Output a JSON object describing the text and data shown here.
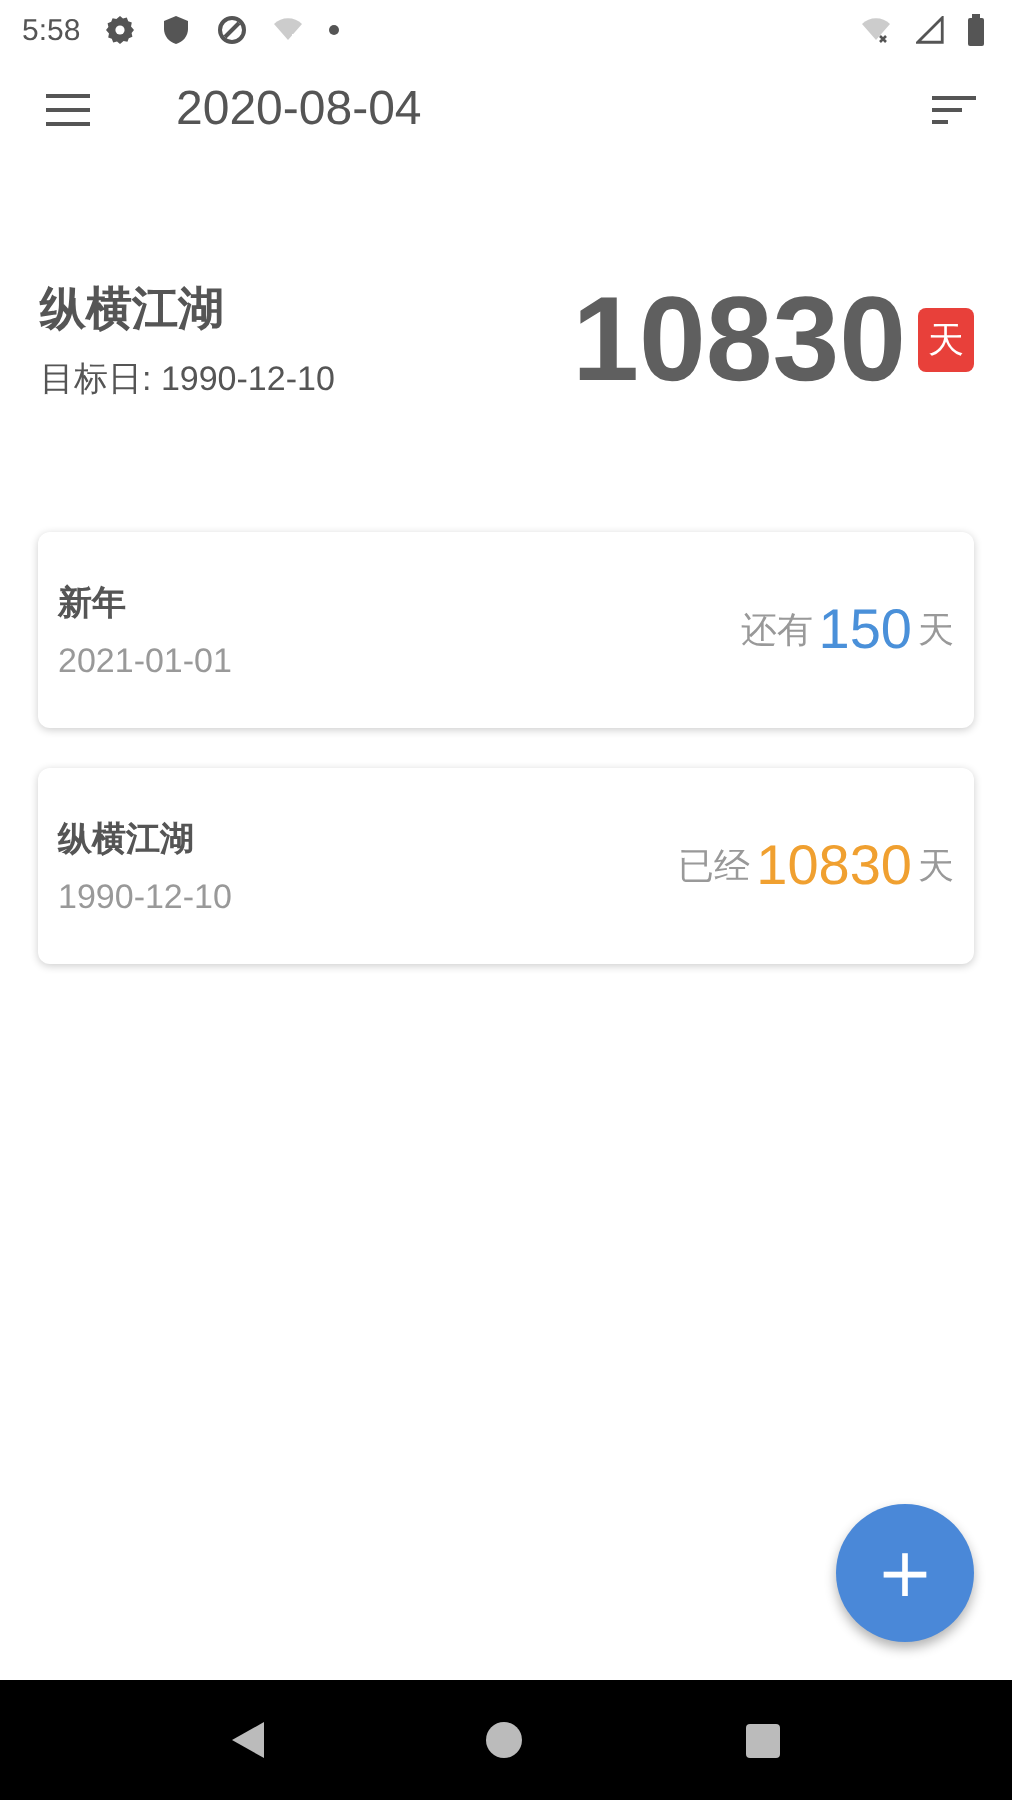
{
  "status_bar": {
    "time": "5:58"
  },
  "toolbar": {
    "title": "2020-08-04"
  },
  "hero": {
    "name": "纵横江湖",
    "target_label": "目标日: 1990-12-10",
    "count": "10830",
    "unit": "天"
  },
  "events": [
    {
      "name": "新年",
      "date": "2021-01-01",
      "prefix": "还有",
      "count": "150",
      "unit": "天",
      "color": "#4a90d9"
    },
    {
      "name": "纵横江湖",
      "date": "1990-12-10",
      "prefix": "已经",
      "count": "10830",
      "unit": "天",
      "color": "#f0a030"
    }
  ],
  "fab": {
    "label": "+"
  }
}
